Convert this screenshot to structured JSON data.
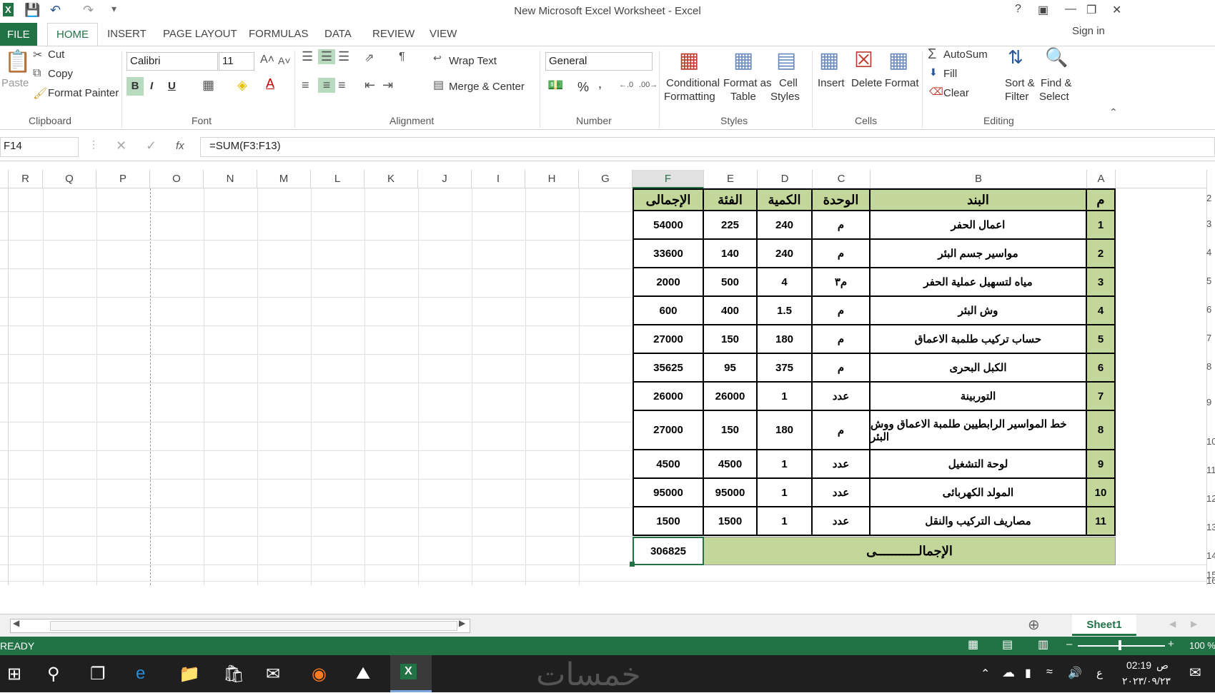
{
  "window": {
    "title": "New Microsoft Excel Worksheet - Excel",
    "help": "?",
    "signin": "Sign in"
  },
  "tabs": [
    "FILE",
    "HOME",
    "INSERT",
    "PAGE LAYOUT",
    "FORMULAS",
    "DATA",
    "REVIEW",
    "VIEW"
  ],
  "ribbon": {
    "clipboard": {
      "paste": "Paste",
      "cut": "Cut",
      "copy": "Copy",
      "format_painter": "Format Painter",
      "label": "Clipboard"
    },
    "font": {
      "name": "Calibri",
      "size": "11",
      "bold": "B",
      "italic": "I",
      "underline": "U",
      "label": "Font"
    },
    "alignment": {
      "wrap": "Wrap Text",
      "merge": "Merge & Center",
      "label": "Alignment"
    },
    "number": {
      "format": "General",
      "percent": "%",
      "comma": ",",
      "label": "Number"
    },
    "styles": {
      "conditional": "Conditional",
      "conditional2": "Formatting",
      "format_as": "Format as",
      "format_as2": "Table",
      "cell": "Cell",
      "cell2": "Styles",
      "label": "Styles"
    },
    "cells": {
      "insert": "Insert",
      "delete": "Delete",
      "format": "Format",
      "label": "Cells"
    },
    "editing": {
      "autosum": "AutoSum",
      "fill": "Fill",
      "clear": "Clear",
      "sort": "Sort &",
      "sort2": "Filter",
      "find": "Find &",
      "find2": "Select",
      "label": "Editing"
    }
  },
  "formula_bar": {
    "name_box": "F14",
    "fx": "fx",
    "formula": "=SUM(F3:F13)"
  },
  "columns": [
    "R",
    "Q",
    "P",
    "O",
    "N",
    "M",
    "L",
    "K",
    "J",
    "I",
    "H",
    "G",
    "F",
    "E",
    "D",
    "C",
    "B",
    "A"
  ],
  "table": {
    "headers": {
      "total": "الإجمالى",
      "price": "الفئة",
      "qty": "الكمية",
      "unit": "الوحدة",
      "item": "البند",
      "no": "م"
    },
    "rows": [
      {
        "total": "54000",
        "price": "225",
        "qty": "240",
        "unit": "م",
        "item": "اعمال الحفر",
        "no": "1"
      },
      {
        "total": "33600",
        "price": "140",
        "qty": "240",
        "unit": "م",
        "item": "مواسير جسم البئر",
        "no": "2"
      },
      {
        "total": "2000",
        "price": "500",
        "qty": "4",
        "unit": "م٣",
        "item": "مياه لتسهيل عملية الحفر",
        "no": "3"
      },
      {
        "total": "600",
        "price": "400",
        "qty": "1.5",
        "unit": "م",
        "item": "وش البئر",
        "no": "4"
      },
      {
        "total": "27000",
        "price": "150",
        "qty": "180",
        "unit": "م",
        "item": "حساب تركيب طلمبة الاعماق",
        "no": "5"
      },
      {
        "total": "35625",
        "price": "95",
        "qty": "375",
        "unit": "م",
        "item": "الكبل البحرى",
        "no": "6"
      },
      {
        "total": "26000",
        "price": "26000",
        "qty": "1",
        "unit": "عدد",
        "item": "التوربينة",
        "no": "7"
      },
      {
        "total": "27000",
        "price": "150",
        "qty": "180",
        "unit": "م",
        "item": "خط المواسير الرابطيين طلمبة الاعماق ووش البئر",
        "no": "8"
      },
      {
        "total": "4500",
        "price": "4500",
        "qty": "1",
        "unit": "عدد",
        "item": "لوحة التشغيل",
        "no": "9"
      },
      {
        "total": "95000",
        "price": "95000",
        "qty": "1",
        "unit": "عدد",
        "item": "المولد الكهربائى",
        "no": "10"
      },
      {
        "total": "1500",
        "price": "1500",
        "qty": "1",
        "unit": "عدد",
        "item": "مصاريف التركيب والنقل",
        "no": "11"
      }
    ],
    "grand_total": "306825",
    "grand_label": "الإجمالـــــــــــى"
  },
  "row_numbers": [
    "2",
    "3",
    "4",
    "5",
    "6",
    "7",
    "8",
    "9",
    "10",
    "11",
    "12",
    "13",
    "14",
    "15",
    "16"
  ],
  "sheet_tab": "Sheet1",
  "status": {
    "ready": "READY",
    "zoom": "100 %"
  },
  "taskbar": {
    "time": "02:19",
    "ampm": "ص",
    "date": "٢٠٢٣/٠٩/٢٣",
    "lang": "ع",
    "watermark": "خمسات"
  }
}
